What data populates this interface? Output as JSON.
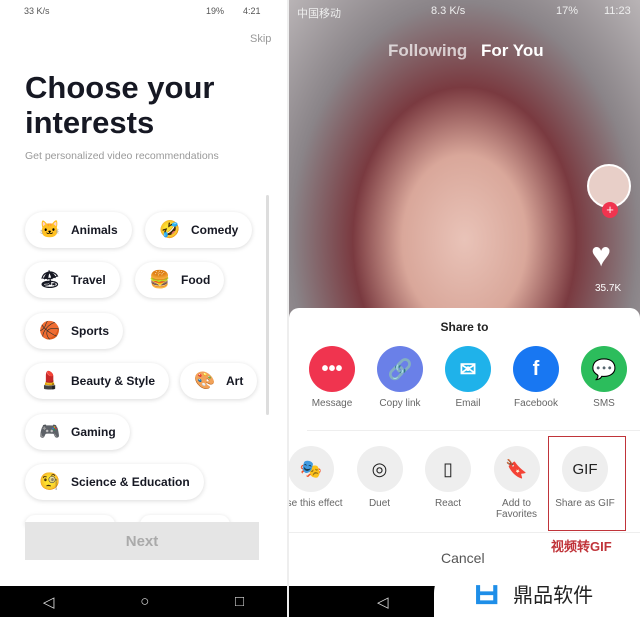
{
  "left": {
    "status": {
      "left": "33 K/s",
      "battery": "19%",
      "time": "4:21"
    },
    "skip": "Skip",
    "title": "Choose your interests",
    "subtitle": "Get personalized video recommendations",
    "interests": [
      {
        "label": "Animals",
        "emoji": "🐱"
      },
      {
        "label": "Comedy",
        "emoji": "🤣"
      },
      {
        "label": "Travel",
        "emoji": "🏖"
      },
      {
        "label": "Food",
        "emoji": "🍔"
      },
      {
        "label": "Sports",
        "emoji": "🏀"
      },
      {
        "label": "Beauty & Style",
        "emoji": "💄"
      },
      {
        "label": "Art",
        "emoji": "🎨"
      },
      {
        "label": "Gaming",
        "emoji": "🎮"
      },
      {
        "label": "Science & Education",
        "emoji": "🧐"
      }
    ],
    "next": "Next"
  },
  "right": {
    "status": {
      "carrier": "中国移动",
      "speed": "8.3 K/s",
      "battery": "17%",
      "time": "11:23"
    },
    "tabs": [
      "Following",
      "For You"
    ],
    "likes": "35.7K",
    "share_title": "Share to",
    "share_targets": [
      {
        "label": "Message",
        "color": "#f0344f",
        "icon": "message-icon"
      },
      {
        "label": "Copy link",
        "color": "#6a80e8",
        "icon": "link-icon"
      },
      {
        "label": "Email",
        "color": "#1fb2ea",
        "icon": "email-icon"
      },
      {
        "label": "Facebook",
        "color": "#1877f2",
        "icon": "facebook-icon"
      },
      {
        "label": "SMS",
        "color": "#2cbd5c",
        "icon": "sms-icon"
      }
    ],
    "actions": [
      {
        "label": "Use this effect",
        "icon": "mask-icon"
      },
      {
        "label": "Duet",
        "icon": "duet-icon"
      },
      {
        "label": "React",
        "icon": "react-icon"
      },
      {
        "label": "Add to Favorites",
        "icon": "bookmark-icon"
      },
      {
        "label": "Share as GIF",
        "icon": "gif-icon",
        "glyph": "GIF"
      }
    ],
    "cancel": "Cancel",
    "annotation": "视频转GIF",
    "highlight_color": "#c0343a",
    "watermark": "鼎品软件"
  }
}
